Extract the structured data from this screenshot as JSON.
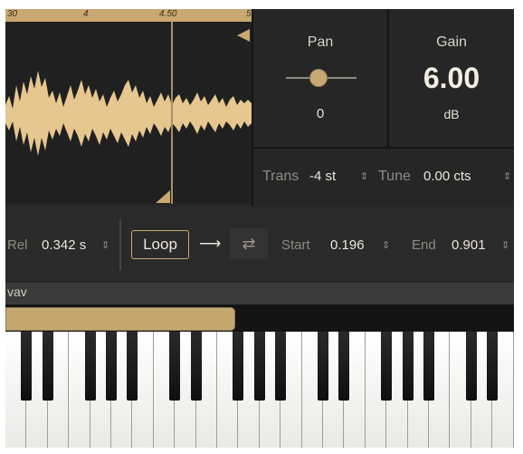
{
  "waveform": {
    "ruler_labels": [
      "30",
      "4",
      "4.50",
      "5"
    ]
  },
  "pan": {
    "title": "Pan",
    "value": "0"
  },
  "gain": {
    "title": "Gain",
    "value": "6.00",
    "unit": "dB"
  },
  "trans": {
    "label": "Trans",
    "value": "-4 st"
  },
  "tune": {
    "label": "Tune",
    "value": "0.00 cts"
  },
  "rel": {
    "label": "Rel",
    "value": "0.342 s"
  },
  "loop": {
    "label": "Loop"
  },
  "start": {
    "label": "Start",
    "value": "0.196"
  },
  "end": {
    "label": "End",
    "value": "0.901"
  },
  "file": {
    "name": "vav"
  },
  "icons": {
    "stepper": "updown-arrows-icon",
    "arrow": "arrow-right-icon",
    "swap": "swap-arrows-icon"
  },
  "colors": {
    "accent": "#c9a871",
    "background": "#262626"
  }
}
